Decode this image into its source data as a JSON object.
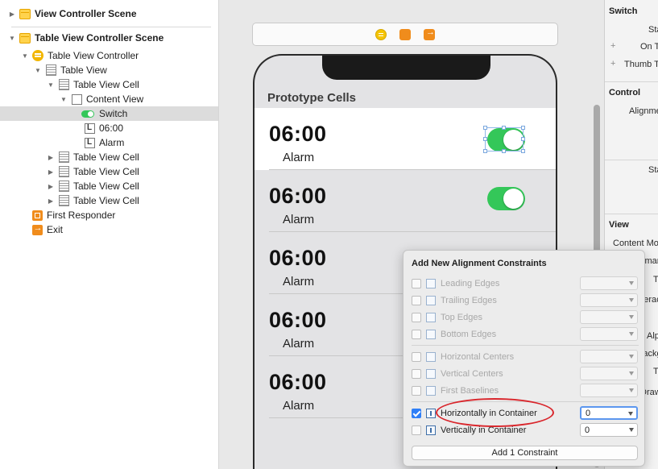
{
  "outline": {
    "items": [
      {
        "label": "View Controller Scene",
        "icon": "scene-icon",
        "bold": true,
        "disclosure": "collapsed"
      },
      {
        "label": "Table View Controller Scene",
        "icon": "scene-icon",
        "bold": true,
        "disclosure": "expanded"
      },
      {
        "label": "Table View Controller",
        "icon": "table-view-controller-icon",
        "disclosure": "expanded"
      },
      {
        "label": "Table View",
        "icon": "table-view-icon",
        "disclosure": "expanded"
      },
      {
        "label": "Table View Cell",
        "icon": "table-view-cell-icon",
        "disclosure": "expanded"
      },
      {
        "label": "Content View",
        "icon": "content-view-icon",
        "disclosure": "expanded"
      },
      {
        "label": "Switch",
        "icon": "switch-icon",
        "selected": true
      },
      {
        "label": "06:00",
        "icon": "label-icon"
      },
      {
        "label": "Alarm",
        "icon": "label-icon"
      },
      {
        "label": "Table View Cell",
        "icon": "table-view-cell-icon",
        "disclosure": "collapsed"
      },
      {
        "label": "Table View Cell",
        "icon": "table-view-cell-icon",
        "disclosure": "collapsed"
      },
      {
        "label": "Table View Cell",
        "icon": "table-view-cell-icon",
        "disclosure": "collapsed"
      },
      {
        "label": "Table View Cell",
        "icon": "table-view-cell-icon",
        "disclosure": "collapsed"
      },
      {
        "label": "First Responder",
        "icon": "first-responder-icon"
      },
      {
        "label": "Exit",
        "icon": "exit-icon"
      }
    ],
    "label_glyph": "L"
  },
  "canvas": {
    "scene_bar_icons": [
      "view-controller-icon",
      "first-responder-icon",
      "exit-icon"
    ],
    "section_header": "Prototype Cells",
    "cells": [
      {
        "time": "06:00",
        "subtitle": "Alarm",
        "switch_on": true,
        "selected": true
      },
      {
        "time": "06:00",
        "subtitle": "Alarm",
        "switch_on": true
      },
      {
        "time": "06:00",
        "subtitle": "Alarm"
      },
      {
        "time": "06:00",
        "subtitle": "Alarm"
      },
      {
        "time": "06:00",
        "subtitle": "Alarm"
      }
    ]
  },
  "inspector": {
    "switch_header": "Switch",
    "switch_rows": [
      "Sta",
      "On T",
      "Thumb T"
    ],
    "control_header": "Control",
    "control_rows": [
      "Alignme",
      "Sta"
    ],
    "view_header": "View",
    "view_rows": [
      "Content Mo",
      "Seman",
      "T",
      "Interact",
      "Alp",
      "Backgrou",
      "T",
      "Drawi"
    ]
  },
  "popover": {
    "title": "Add New Alignment Constraints",
    "rows": [
      {
        "label": "Leading Edges",
        "checked": false,
        "enabled": false,
        "value": ""
      },
      {
        "label": "Trailing Edges",
        "checked": false,
        "enabled": false,
        "value": ""
      },
      {
        "label": "Top Edges",
        "checked": false,
        "enabled": false,
        "value": ""
      },
      {
        "label": "Bottom Edges",
        "checked": false,
        "enabled": false,
        "value": ""
      },
      {
        "label": "Horizontal Centers",
        "checked": false,
        "enabled": false,
        "value": ""
      },
      {
        "label": "Vertical Centers",
        "checked": false,
        "enabled": false,
        "value": ""
      },
      {
        "label": "First Baselines",
        "checked": false,
        "enabled": false,
        "value": ""
      },
      {
        "label": "Horizontally in Container",
        "checked": true,
        "enabled": true,
        "value": "0",
        "focused": true
      },
      {
        "label": "Vertically in Container",
        "checked": false,
        "enabled": true,
        "value": "0"
      }
    ],
    "add_button": "Add 1 Constraint",
    "highlight_color": "#d9262c"
  },
  "colors": {
    "switch_green": "#34c759",
    "accent_blue": "#2f7ff7",
    "selection_gray": "#dcdcdc"
  }
}
